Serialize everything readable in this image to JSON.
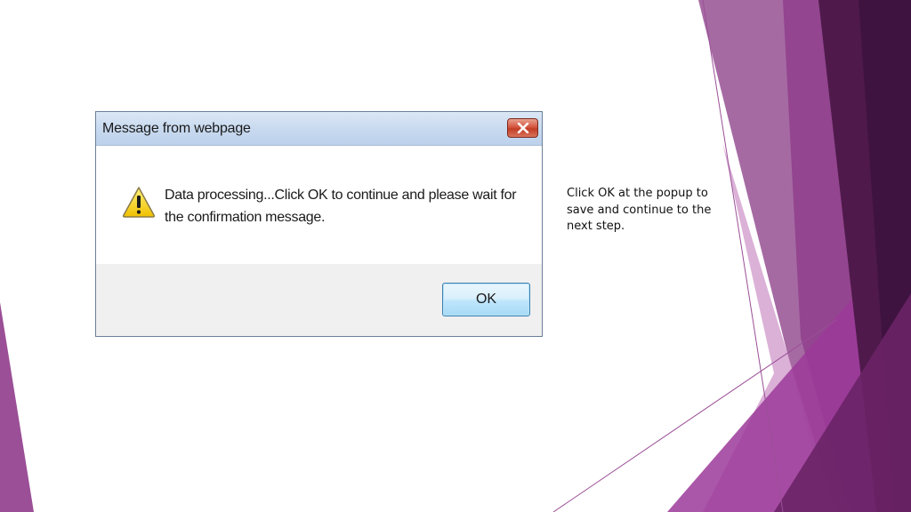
{
  "dialog": {
    "title": "Message from webpage",
    "message": "Data processing...Click OK to continue and please wait for the confirmation message.",
    "ok_label": "OK",
    "icon": "warning-icon",
    "close_icon": "close-icon"
  },
  "caption": "Click OK at the popup to save and continue to the next step.",
  "colors": {
    "purple_dark": "#4e1a4a",
    "purple_mid": "#8f3f8c",
    "purple_light": "#c487c0",
    "close_red": "#c8432b",
    "ok_blue_border": "#3c7fb1"
  }
}
